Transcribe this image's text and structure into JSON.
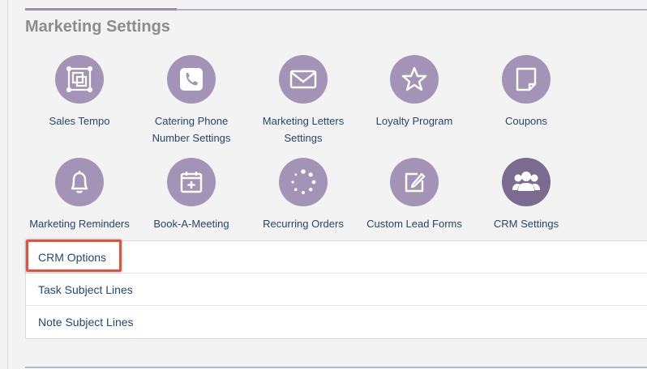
{
  "page": {
    "title": "Marketing Settings"
  },
  "tiles": [
    {
      "label": "Sales Tempo",
      "icon": "sales-tempo-icon"
    },
    {
      "label": "Catering Phone Number Settings",
      "icon": "phone-icon"
    },
    {
      "label": "Marketing Letters Settings",
      "icon": "envelope-icon"
    },
    {
      "label": "Loyalty Program",
      "icon": "star-icon"
    },
    {
      "label": "Coupons",
      "icon": "coupon-icon"
    },
    {
      "label": "Marketing Reminders",
      "icon": "bell-icon"
    },
    {
      "label": "Book-A-Meeting",
      "icon": "calendar-plus-icon"
    },
    {
      "label": "Recurring Orders",
      "icon": "loading-dots-icon"
    },
    {
      "label": "Custom Lead Forms",
      "icon": "edit-form-icon"
    },
    {
      "label": "CRM Settings",
      "icon": "users-icon"
    }
  ],
  "crm_options": [
    "CRM Options",
    "Task Subject Lines",
    "Note Subject Lines"
  ],
  "colors": {
    "icon_circle": "#a394b7",
    "icon_circle_active": "#7b6b91",
    "link": "#24476b",
    "highlight": "#e0533e"
  }
}
